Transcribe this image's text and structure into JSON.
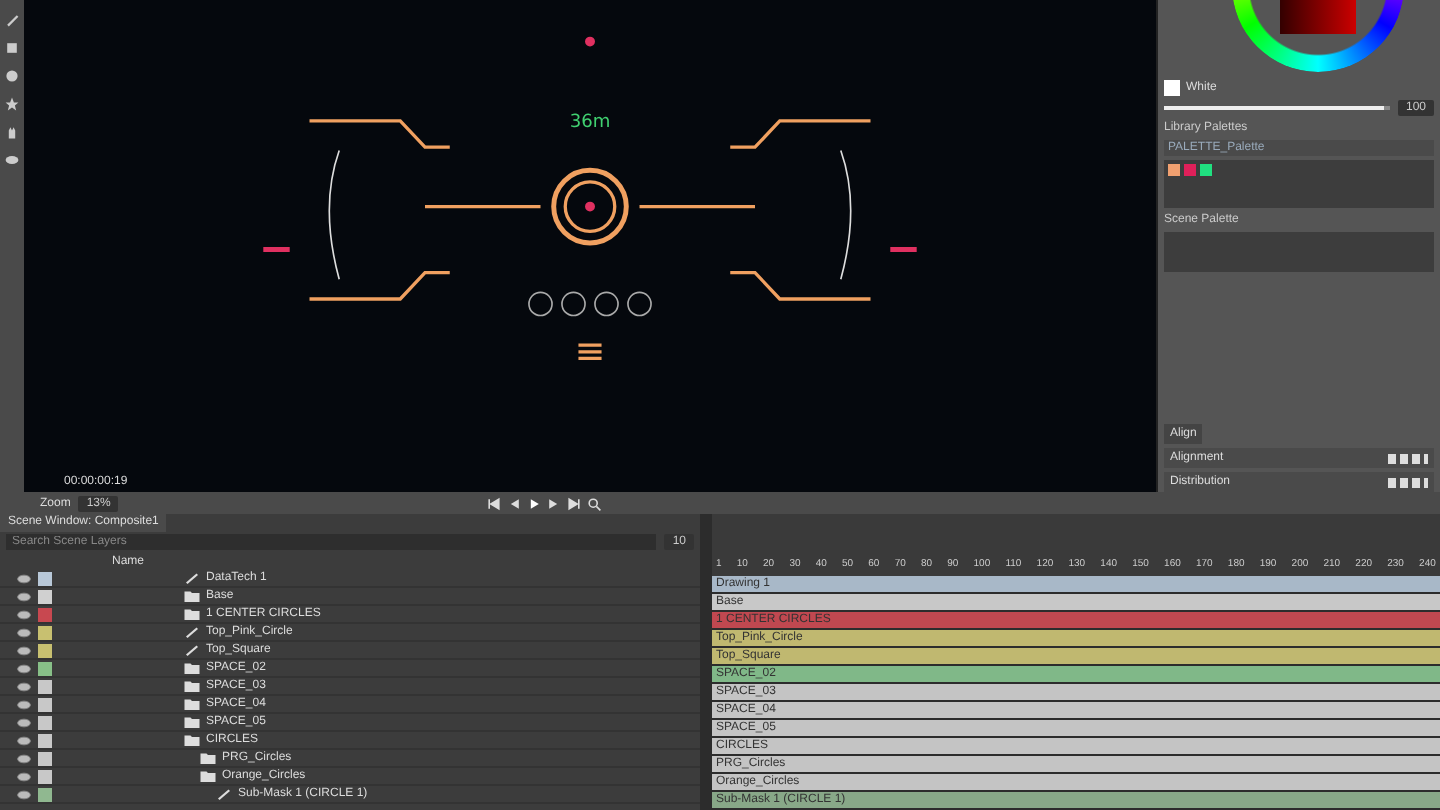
{
  "viewer": {
    "readout": "36m",
    "timecode": "00:00:00:19",
    "zoom_label": "Zoom",
    "zoom_value": "13%"
  },
  "color_panel": {
    "swatch_name": "White",
    "slider": {
      "level": 0.97,
      "reading": "100"
    },
    "library_title": "Library Palettes",
    "palette_name": "PALETTE_Palette",
    "swatches": [
      {
        "color": "#f0a070"
      },
      {
        "color": "#e0205a"
      },
      {
        "color": "#20e080"
      }
    ],
    "scene_title": "Scene Palette"
  },
  "align_panel": {
    "tab": "Align",
    "rows": [
      "Alignment",
      "Distribution"
    ]
  },
  "scene_window": {
    "title": "Scene Window: Composite1",
    "search": {
      "placeholder": "Search Scene Layers"
    },
    "column": "Name",
    "frame_field": "10",
    "layers": [
      {
        "name": "DataTech 1",
        "kind": "drawing",
        "color": "#b8c8d8",
        "visible": true
      },
      {
        "name": "Base",
        "kind": "folder",
        "color": "#d0d0d0",
        "visible": true
      },
      {
        "name": "1 CENTER CIRCLES",
        "kind": "folder",
        "color": "#c84850",
        "visible": true
      },
      {
        "name": "Top_Pink_Circle",
        "kind": "drawing",
        "color": "#c8c070",
        "visible": true
      },
      {
        "name": "Top_Square",
        "kind": "drawing",
        "color": "#c8c070",
        "visible": true
      },
      {
        "name": "SPACE_02",
        "kind": "folder",
        "color": "#88c088",
        "visible": true
      },
      {
        "name": "SPACE_03",
        "kind": "folder",
        "color": "#c8c8c8",
        "visible": true
      },
      {
        "name": "SPACE_04",
        "kind": "folder",
        "color": "#c8c8c8",
        "visible": true
      },
      {
        "name": "SPACE_05",
        "kind": "folder",
        "color": "#c8c8c8",
        "visible": true
      },
      {
        "name": "CIRCLES",
        "kind": "folder",
        "color": "#c8c8c8",
        "visible": true,
        "children": [
          {
            "name": "PRG_Circles",
            "kind": "folder",
            "color": "#c8c8c8",
            "visible": true
          },
          {
            "name": "Orange_Circles",
            "kind": "folder",
            "color": "#c8c8c8",
            "visible": true,
            "children": [
              {
                "name": "Sub-Mask 1 (CIRCLE 1)",
                "kind": "drawing",
                "color": "#90b890",
                "visible": true
              }
            ]
          }
        ]
      }
    ]
  },
  "timeline": {
    "ticks": [
      "1",
      "10",
      "20",
      "30",
      "40",
      "50",
      "60",
      "70",
      "80",
      "90",
      "100",
      "110",
      "120",
      "130",
      "140",
      "150",
      "160",
      "170",
      "180",
      "190",
      "200",
      "210",
      "220",
      "230",
      "240"
    ],
    "tracks": [
      {
        "label": "Drawing 1",
        "color": "#a8b8c8"
      },
      {
        "label": "Base",
        "color": "#c8c8c8"
      },
      {
        "label": "1 CENTER CIRCLES",
        "color": "#c04850"
      },
      {
        "label": "Top_Pink_Circle",
        "color": "#c0b870"
      },
      {
        "label": "Top_Square",
        "color": "#c0b870"
      },
      {
        "label": "SPACE_02",
        "color": "#80b888"
      },
      {
        "label": "SPACE_03",
        "color": "#c4c4c4"
      },
      {
        "label": "SPACE_04",
        "color": "#c4c4c4"
      },
      {
        "label": "SPACE_05",
        "color": "#c4c4c4"
      },
      {
        "label": "CIRCLES",
        "color": "#c4c4c4"
      },
      {
        "label": "PRG_Circles",
        "color": "#c4c4c4"
      },
      {
        "label": "Orange_Circles",
        "color": "#c4c4c4"
      },
      {
        "label": "Sub-Mask 1 (CIRCLE 1)",
        "color": "#88a888"
      }
    ]
  }
}
